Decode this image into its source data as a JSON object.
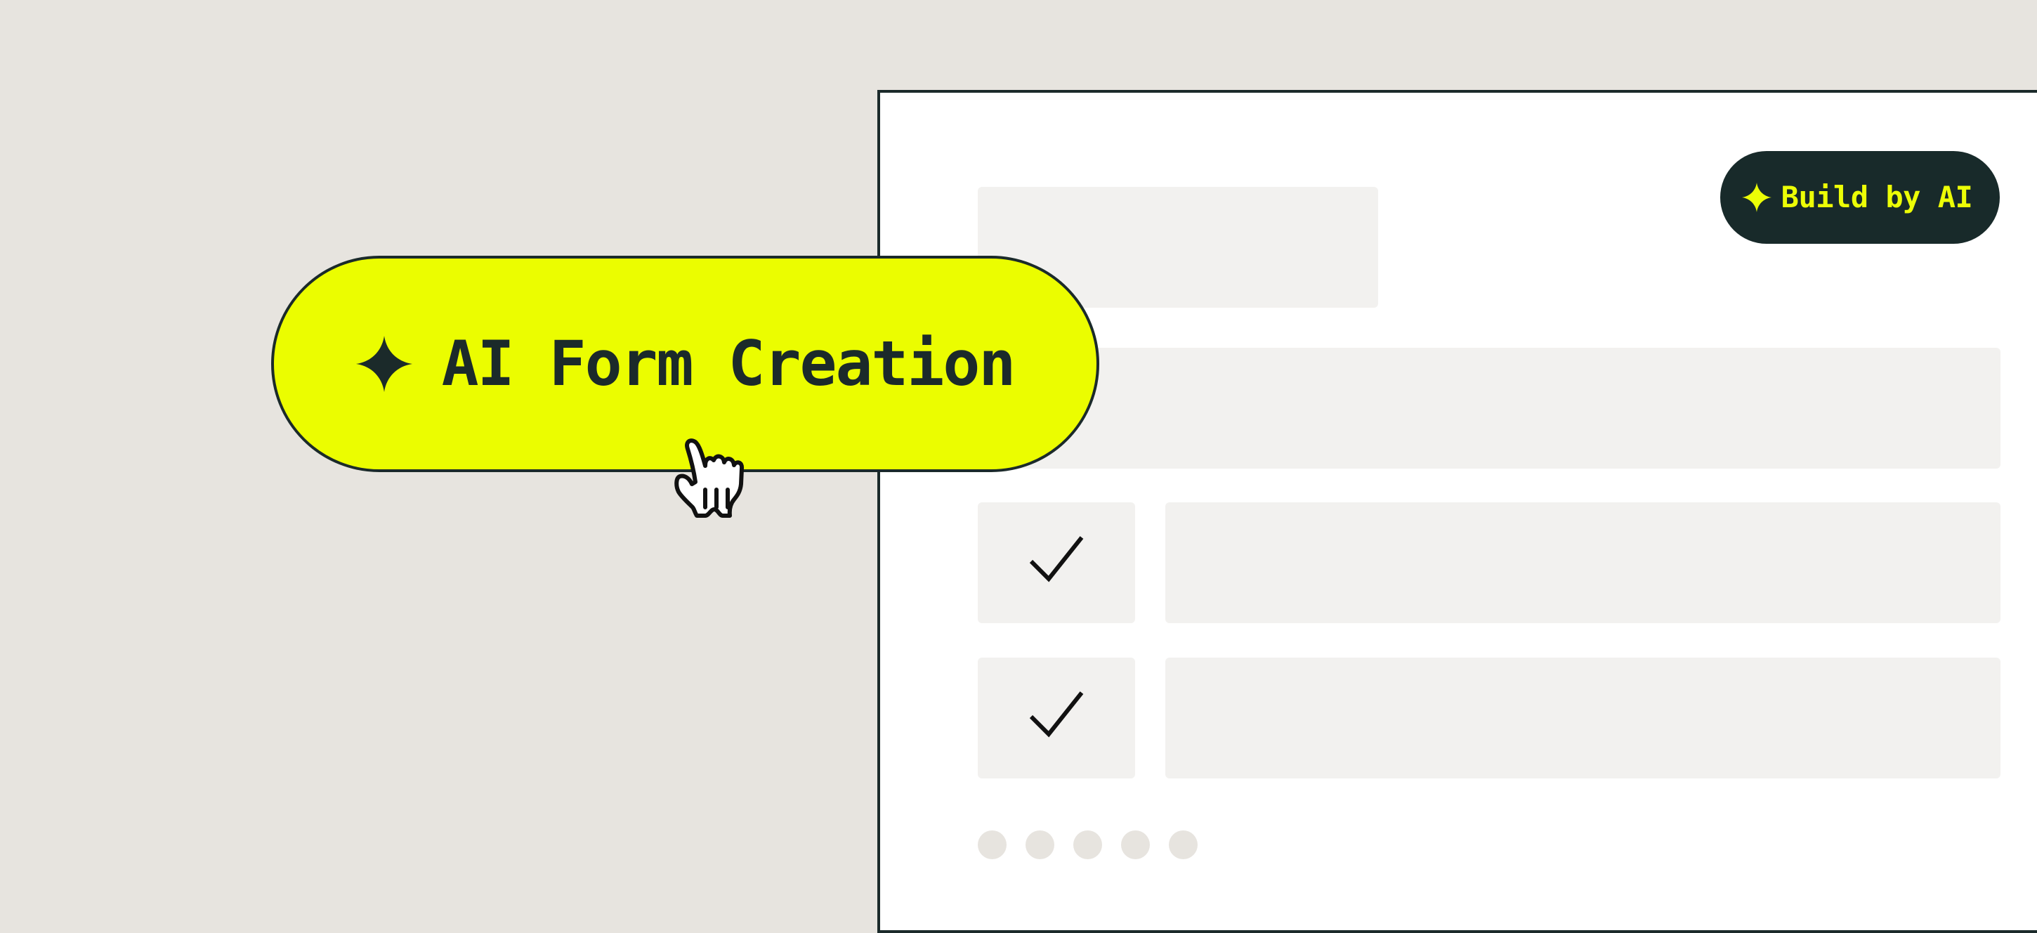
{
  "feature_pill": {
    "label": "AI Form Creation",
    "icon": "sparkle-icon",
    "background": "#ebfd00",
    "text_color": "#1b2a2a"
  },
  "builder": {
    "button_label": "Build by AI",
    "button_icon": "sparkle-icon",
    "button_background": "#182a2a",
    "button_text_color": "#ecfe06"
  },
  "checkbox_rows": [
    {
      "checked": true,
      "icon": "check-icon"
    },
    {
      "checked": true,
      "icon": "check-icon"
    }
  ],
  "pagination": {
    "dots": 5
  },
  "cursor": {
    "icon": "hand-pointer-icon"
  },
  "colors": {
    "page_background": "#e7e4df",
    "form_background": "#ffffff",
    "placeholder": "#f2f1ef",
    "outline": "#1b2a2a"
  }
}
